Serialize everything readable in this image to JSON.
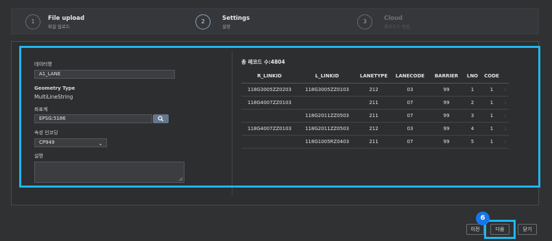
{
  "steps": [
    {
      "number": "1",
      "title": "File upload",
      "subtitle": "파일 업로드"
    },
    {
      "number": "2",
      "title": "Settings",
      "subtitle": "설정"
    },
    {
      "number": "3",
      "title": "Cloud",
      "subtitle": "클라우드 변환"
    }
  ],
  "form": {
    "data_name_label": "데이터명",
    "data_name_value": "A1_LANE",
    "geometry_type_label": "Geometry Type",
    "geometry_type_value": "MultiLineString",
    "crs_label": "좌표계",
    "crs_value": "EPSG:5186",
    "encoding_label": "속성 인코딩",
    "encoding_value": "CP949",
    "description_label": "설명"
  },
  "table": {
    "record_count": "총 레코드 수:4804",
    "columns": [
      "R_LINKID",
      "L_LINKID",
      "LANETYPE",
      "LANECODE",
      "BARRIER",
      "LNO",
      "CODE",
      ""
    ],
    "rows": [
      [
        "118G3005ZZ0203",
        "118G3005ZZ0103",
        "212",
        "03",
        "99",
        "1",
        "1",
        ":"
      ],
      [
        "118G4007ZZ0103",
        "",
        "211",
        "07",
        "99",
        "2",
        "1",
        ":"
      ],
      [
        "",
        "118G2011ZZ0503",
        "211",
        "07",
        "99",
        "3",
        "1",
        ":"
      ],
      [
        "118G4007ZZ0103",
        "118G2011ZZ0503",
        "212",
        "03",
        "99",
        "4",
        "1",
        ":"
      ],
      [
        "",
        "118G1005RZ0403",
        "211",
        "07",
        "99",
        "5",
        "1",
        ":"
      ]
    ]
  },
  "buttons": {
    "prev": "이전",
    "next": "다음",
    "close": "닫기"
  },
  "annotation": {
    "badge": "6"
  },
  "colors": {
    "highlight": "#1fb8f0",
    "badge": "#1976e8",
    "accent_step": "#8aa8c8"
  }
}
